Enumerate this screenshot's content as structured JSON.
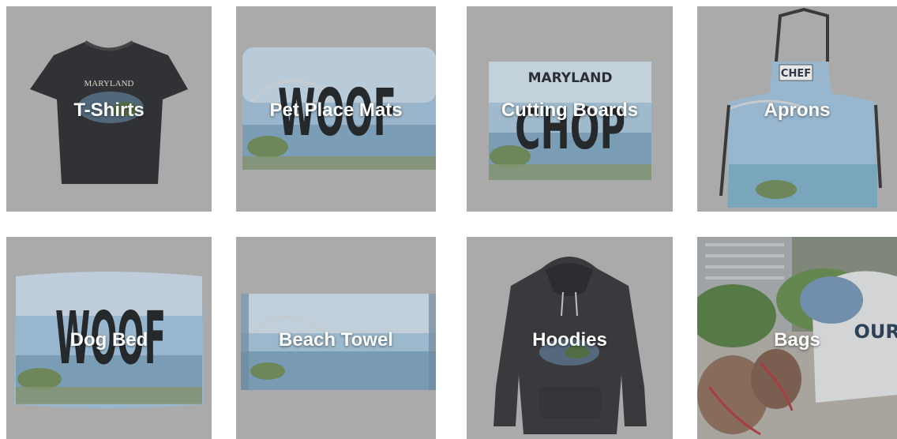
{
  "categories": [
    {
      "label": "T-Shirts",
      "print": "MARYLAND"
    },
    {
      "label": "Pet Place Mats",
      "print": "WOOF"
    },
    {
      "label": "Cutting Boards",
      "print": "MARYLAND",
      "print2": "CHOP"
    },
    {
      "label": "Aprons",
      "print": "CHEF"
    },
    {
      "label": "Dog Bed",
      "print": "WOOF"
    },
    {
      "label": "Beach Towel"
    },
    {
      "label": "Hoodies"
    },
    {
      "label": "Bags",
      "print": "OUR E"
    }
  ]
}
